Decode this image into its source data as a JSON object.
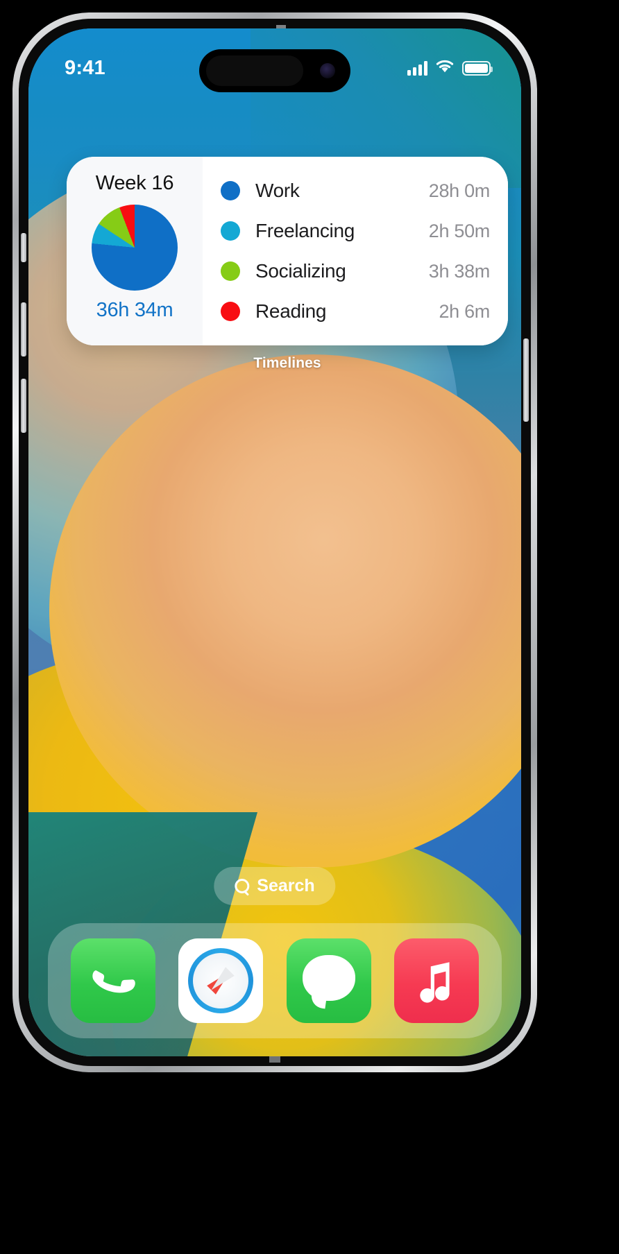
{
  "device": {
    "name": "iphone-14-pro"
  },
  "status_bar": {
    "time": "9:41",
    "cellular_icon": "cellular-bars-icon",
    "wifi_icon": "wifi-icon",
    "battery_icon": "battery-full-icon"
  },
  "widget": {
    "caption": "Timelines",
    "week_label": "Week 16",
    "total_time": "36h 34m",
    "rows": [
      {
        "label": "Work",
        "value": "28h 0m",
        "color": "#0f6fc6"
      },
      {
        "label": "Freelancing",
        "value": "2h 50m",
        "color": "#14a8d4"
      },
      {
        "label": "Socializing",
        "value": "3h 38m",
        "color": "#86cc16"
      },
      {
        "label": "Reading",
        "value": "2h 6m",
        "color": "#f80d12"
      }
    ]
  },
  "chart_data": {
    "type": "pie",
    "title": "Week 16",
    "categories": [
      "Work",
      "Freelancing",
      "Socializing",
      "Reading"
    ],
    "values": [
      28.0,
      2.8333,
      3.6333,
      2.1
    ],
    "value_labels": [
      "28h 0m",
      "2h 50m",
      "3h 38m",
      "2h 6m"
    ],
    "colors": [
      "#0f6fc6",
      "#14a8d4",
      "#86cc16",
      "#f80d12"
    ],
    "total": 36.5667,
    "total_label": "36h 34m",
    "unit": "hours",
    "legend": "right"
  },
  "search": {
    "label": "Search",
    "icon": "search-icon"
  },
  "dock": {
    "apps": [
      {
        "name": "Phone",
        "icon": "phone-icon"
      },
      {
        "name": "Safari",
        "icon": "safari-compass-icon"
      },
      {
        "name": "Messages",
        "icon": "messages-bubble-icon"
      },
      {
        "name": "Music",
        "icon": "music-note-icon"
      }
    ]
  }
}
